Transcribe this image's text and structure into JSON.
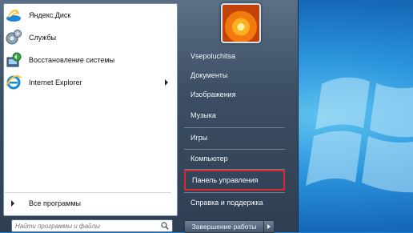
{
  "start_menu": {
    "programs": [
      {
        "label": "Яндекс.Диск",
        "icon": "yandex-disk-icon",
        "has_submenu": false
      },
      {
        "label": "Службы",
        "icon": "services-gear-icon",
        "has_submenu": false
      },
      {
        "label": "Восстановление системы",
        "icon": "system-restore-icon",
        "has_submenu": false
      },
      {
        "label": "Internet Explorer",
        "icon": "internet-explorer-icon",
        "has_submenu": true
      }
    ],
    "all_programs_label": "Все программы",
    "search": {
      "placeholder": "Найти программы и файлы",
      "value": ""
    },
    "right_items": [
      {
        "label": "Vsepoluchitsa"
      },
      {
        "label": "Документы"
      },
      {
        "label": "Изображения"
      },
      {
        "label": "Музыка"
      },
      {
        "label": "Игры"
      },
      {
        "label": "Компьютер"
      },
      {
        "label": "Панель управления",
        "highlighted": true
      },
      {
        "label": "Справка и поддержка"
      }
    ],
    "shutdown_label": "Завершение работы"
  },
  "colors": {
    "highlight": "#e0262f",
    "wallpaper": "#2b95dd",
    "menu_dark": "#3c4e64"
  }
}
